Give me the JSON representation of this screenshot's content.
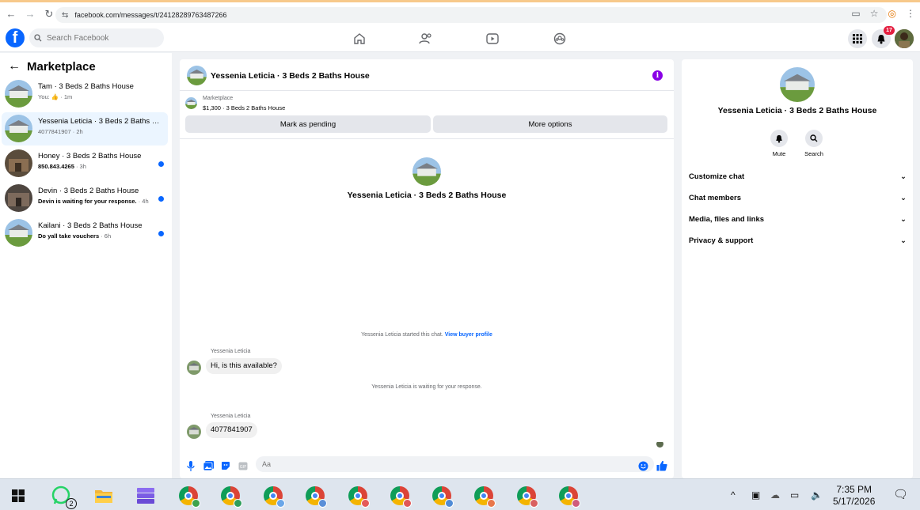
{
  "browser": {
    "url": "facebook.com/messages/t/24128289763487266",
    "back_icon": "back-arrow-icon",
    "forward_icon": "forward-arrow-icon",
    "reload_icon": "reload-icon"
  },
  "header": {
    "logo": "f",
    "search_placeholder": "Search Facebook",
    "notification_count": "17",
    "colors": {
      "brand": "#0866ff",
      "badge": "#e41e3f",
      "info": "#8a00e6"
    }
  },
  "left": {
    "title": "Marketplace",
    "conversations": [
      {
        "name": "Tam · 3 Beds 2 Baths House",
        "sub_prefix": "You: ",
        "sub": "👍",
        "time": " · 1m",
        "unread": false,
        "active": false
      },
      {
        "name": "Yessenia Leticia · 3 Beds 2 Baths H...",
        "sub_prefix": "",
        "sub": "4077841907",
        "time": " · 2h",
        "unread": false,
        "active": true
      },
      {
        "name": "Honey · 3 Beds 2 Baths House",
        "sub_prefix": "",
        "sub": "850.843.4265",
        "time": " · 3h",
        "unread": true,
        "active": false
      },
      {
        "name": "Devin · 3 Beds 2 Baths House",
        "sub_prefix": "",
        "sub": "Devin is waiting for your response.",
        "time": " · 4h",
        "unread": true,
        "active": false
      },
      {
        "name": "Kailani · 3 Beds 2 Baths House",
        "sub_prefix": "",
        "sub": "Do yall take vouchers",
        "time": " · 6h",
        "unread": true,
        "active": false
      }
    ]
  },
  "chat": {
    "title": "Yessenia Leticia · 3 Beds 2 Baths House",
    "marketplace_label": "Marketplace",
    "listing": "$1,300 · 3 Beds 2 Baths House",
    "mark_pending": "Mark as pending",
    "more_options": "More options",
    "intro_name": "Yessenia Leticia · 3 Beds 2 Baths House",
    "started_text": "Yessenia Leticia started this chat. ",
    "view_profile": "View buyer profile",
    "sender1": "Yessenia Leticia",
    "message1": "Hi, is this available?",
    "waiting_text": "Yessenia Leticia is waiting for your response.",
    "sender2": "Yessenia Leticia",
    "message2": "4077841907",
    "composer_placeholder": "Aa"
  },
  "right": {
    "name": "Yessenia Leticia · 3 Beds 2 Baths House",
    "mute": "Mute",
    "search": "Search",
    "sections": [
      "Customize chat",
      "Chat members",
      "Media, files and links",
      "Privacy & support"
    ]
  },
  "taskbar": {
    "whatsapp_count": "2",
    "time": "7:35 PM",
    "date": "5/17/2026",
    "chrome_profile_colors": [
      "#3fa34d",
      "#2e9e5b",
      "#6aa6e8",
      "#5a8fd8",
      "#e45a5a",
      "#e05757",
      "#4f8bd6",
      "#e8774b",
      "#d96060",
      "#cf5b7c"
    ]
  }
}
